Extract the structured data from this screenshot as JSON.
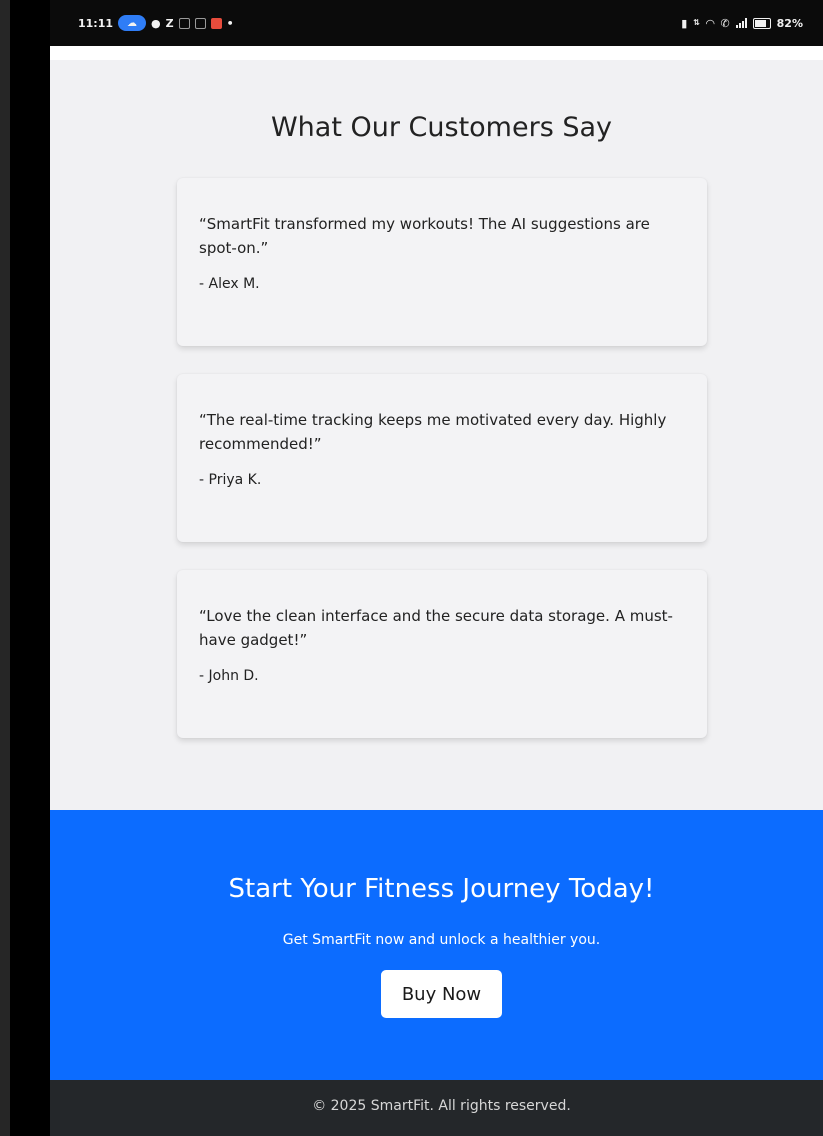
{
  "status_bar": {
    "time": "11:11",
    "z_label": "Z",
    "battery_percent": "82%",
    "icons": [
      "cloud-pill-icon",
      "chat-bubble-icon",
      "app-icon",
      "app-icon",
      "red-app-icon",
      "dot-icon",
      "vibrate-icon",
      "data-speed-icon",
      "wifi-icon",
      "call-icon",
      "signal-icon",
      "battery-icon"
    ]
  },
  "testimonials": {
    "title": "What Our Customers Say",
    "items": [
      {
        "quote": "“SmartFit transformed my workouts! The AI suggestions are spot-on.”",
        "author": "- Alex M."
      },
      {
        "quote": "“The real-time tracking keeps me motivated every day. Highly recommended!”",
        "author": "- Priya K."
      },
      {
        "quote": "“Love the clean interface and the secure data storage. A must-have gadget!”",
        "author": "- John D."
      }
    ]
  },
  "cta": {
    "title": "Start Your Fitness Journey Today!",
    "subtitle": "Get SmartFit now and unlock a healthier you.",
    "button_label": "Buy Now"
  },
  "footer": {
    "text": "© 2025 SmartFit. All rights reserved."
  },
  "colors": {
    "page_background": "#f1f1f3",
    "cta_background": "#0c6cff",
    "footer_background": "#24272a"
  }
}
